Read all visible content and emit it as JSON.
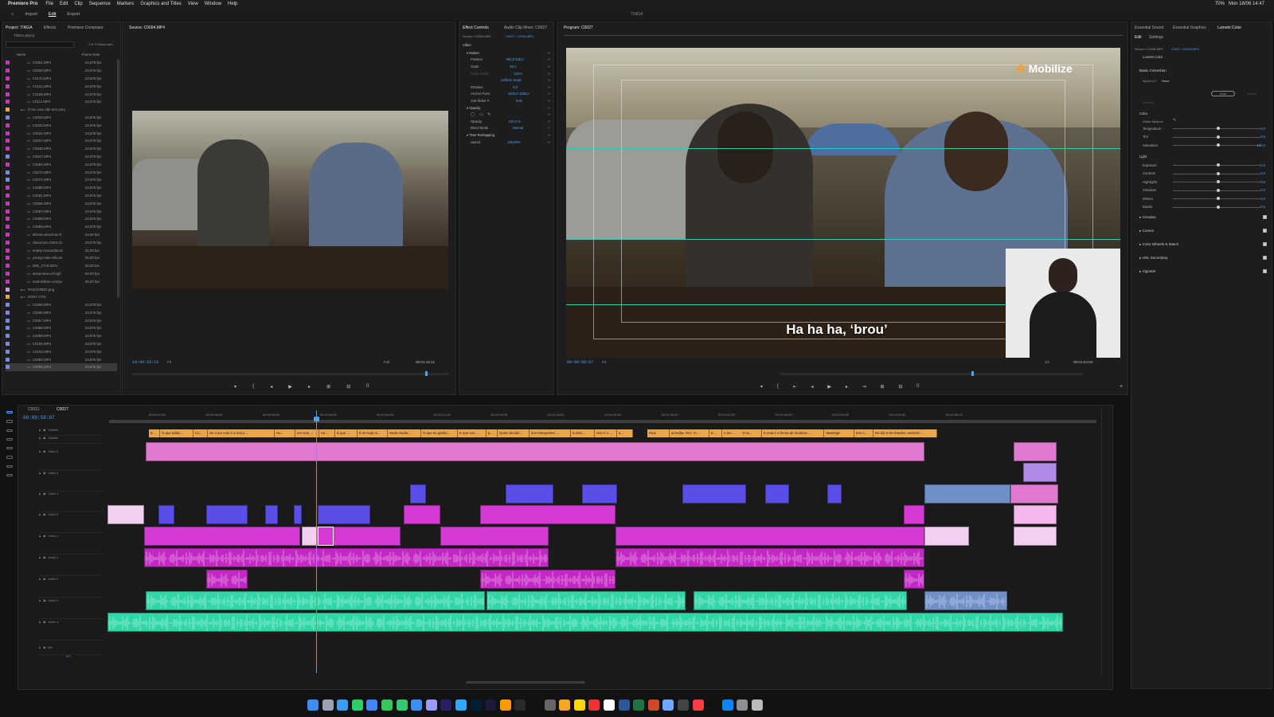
{
  "os_menu": {
    "app_name": "Premiere Pro",
    "items": [
      "File",
      "Edit",
      "Clip",
      "Sequence",
      "Markers",
      "Graphics and Titles",
      "View",
      "Window",
      "Help"
    ],
    "clock": "Mon 18/06  14:47",
    "battery": "70%"
  },
  "window_title": "TINGA",
  "workspaces": [
    "Import",
    "Edit",
    "Export"
  ],
  "active_workspace": "Edit",
  "project_panel": {
    "tabs": [
      "Project: TINGA",
      "Effects",
      "Premiere Composer"
    ],
    "project_file": "TINGA.prproj",
    "item_count": "1 of 74 items sele...",
    "col_name": "Name",
    "col_rate": "Frame Rate",
    "items": [
      {
        "name": "C0061.MP4",
        "rate": "23,976 fps",
        "color": "#c23bb6",
        "indent": 2
      },
      {
        "name": "C0063.MP4",
        "rate": "23,976 fps",
        "color": "#c23bb6",
        "indent": 2
      },
      {
        "name": "C0170.MP4",
        "rate": "23,976 fps",
        "color": "#c23bb6",
        "indent": 2
      },
      {
        "name": "C0101.MP4",
        "rate": "23,976 fps",
        "color": "#c23bb6",
        "indent": 2
      },
      {
        "name": "C0109.MP4",
        "rate": "23,976 fps",
        "color": "#c23bb6",
        "indent": 2
      },
      {
        "name": "C0111.MP4",
        "rate": "23,976 fps",
        "color": "#c23bb6",
        "indent": 2
      },
      {
        "name": "O teu voto não tem preç",
        "rate": "",
        "color": "#e8a54a",
        "indent": 1
      },
      {
        "name": "C0009.MP4",
        "rate": "23,976 fps",
        "color": "#7a8cd8",
        "indent": 2
      },
      {
        "name": "C0020.MP4",
        "rate": "23,976 fps",
        "color": "#c23bb6",
        "indent": 2
      },
      {
        "name": "C0024.MP4",
        "rate": "23,976 fps",
        "color": "#c23bb6",
        "indent": 2
      },
      {
        "name": "C0027.MP4",
        "rate": "23,976 fps",
        "color": "#c23bb6",
        "indent": 2
      },
      {
        "name": "C0038.MP4",
        "rate": "23,976 fps",
        "color": "#c23bb6",
        "indent": 2
      },
      {
        "name": "C0047.MP4",
        "rate": "23,976 fps",
        "color": "#7a8cd8",
        "indent": 2
      },
      {
        "name": "C0053.MP4",
        "rate": "23,976 fps",
        "color": "#c23bb6",
        "indent": 2
      },
      {
        "name": "C0072.MP4",
        "rate": "23,976 fps",
        "color": "#7a8cd8",
        "indent": 2
      },
      {
        "name": "C0074.MP4",
        "rate": "23,976 fps",
        "color": "#7a8cd8",
        "indent": 2
      },
      {
        "name": "C0080.MP4",
        "rate": "23,976 fps",
        "color": "#c23bb6",
        "indent": 2
      },
      {
        "name": "C0081.MP4",
        "rate": "23,976 fps",
        "color": "#c23bb6",
        "indent": 2
      },
      {
        "name": "C0085.MP4",
        "rate": "23,976 fps",
        "color": "#c23bb6",
        "indent": 2
      },
      {
        "name": "C0087.MP4",
        "rate": "23,976 fps",
        "color": "#c23bb6",
        "indent": 2
      },
      {
        "name": "C0088.MP4",
        "rate": "23,976 fps",
        "color": "#c23bb6",
        "indent": 2
      },
      {
        "name": "C0099.MP4",
        "rate": "23,976 fps",
        "color": "#c23bb6",
        "indent": 2
      },
      {
        "name": "african-american-b",
        "rate": "24,00 fps",
        "color": "#c23bb6",
        "indent": 2
      },
      {
        "name": "classroom-2023-11-",
        "rate": "23,976 fps",
        "color": "#c23bb6",
        "indent": 2
      },
      {
        "name": "empty-mozambican",
        "rate": "25,00 fps",
        "color": "#c23bb6",
        "indent": 2
      },
      {
        "name": "young-male-african",
        "rate": "25,00 fps",
        "color": "#c23bb6",
        "indent": 2
      },
      {
        "name": "IMG_4719.MOV",
        "rate": "30,00 fps",
        "color": "#c23bb6",
        "indent": 2
      },
      {
        "name": "aerial-view-of-high",
        "rate": "50,00 fps",
        "color": "#c23bb6",
        "indent": 2
      },
      {
        "name": "load-dollars-compu",
        "rate": "30,00 fps",
        "color": "#c23bb6",
        "indent": 2
      },
      {
        "name": "PASCORDO.png",
        "rate": "",
        "color": "#c8a0d8",
        "indent": 1
      },
      {
        "name": "SONY A7IV",
        "rate": "",
        "color": "#e8a54a",
        "indent": 1
      },
      {
        "name": "C0065.MP4",
        "rate": "23,976 fps",
        "color": "#7a8cd8",
        "indent": 2
      },
      {
        "name": "C0066.MP4",
        "rate": "23,976 fps",
        "color": "#7a8cd8",
        "indent": 2
      },
      {
        "name": "C0067.MP4",
        "rate": "23,976 fps",
        "color": "#7a8cd8",
        "indent": 2
      },
      {
        "name": "C0068.MP4",
        "rate": "23,976 fps",
        "color": "#7a8cd8",
        "indent": 2
      },
      {
        "name": "C0069.MP4",
        "rate": "23,976 fps",
        "color": "#7a8cd8",
        "indent": 2
      },
      {
        "name": "C0190.MP4",
        "rate": "23,976 fps",
        "color": "#7a8cd8",
        "indent": 2
      },
      {
        "name": "C0192.MP4",
        "rate": "23,976 fps",
        "color": "#7a8cd8",
        "indent": 2
      },
      {
        "name": "C0094.MP4",
        "rate": "23,976 fps",
        "color": "#7a8cd8",
        "indent": 2
      },
      {
        "name": "C0095.MP4",
        "rate": "23,976 fps",
        "color": "#7a8cd8",
        "indent": 2
      }
    ]
  },
  "source_monitor": {
    "tab": "Source: C0094.MP4",
    "timecode": "18:40:33:23",
    "fit": "Fit",
    "quality": "Full",
    "duration": "00:01:15:11"
  },
  "effect_controls": {
    "tabs": [
      "Effect Controls",
      "Audio Clip Mixer: C0027"
    ],
    "master": "Source • C0094.MP4",
    "clip": "C0027 • C0094.MP4",
    "section_video": "Video",
    "rows": [
      {
        "label": "Motion",
        "value": "",
        "indent": 1,
        "section": true
      },
      {
        "label": "Position",
        "value": "960,0    540,0",
        "indent": 2
      },
      {
        "label": "Scale",
        "value": "50,0",
        "indent": 2
      },
      {
        "label": "Scale Width",
        "value": "100,0",
        "indent": 2,
        "dim": true
      },
      {
        "label": "",
        "value": "Uniform Scale",
        "indent": 3
      },
      {
        "label": "Rotation",
        "value": "0,0",
        "indent": 2
      },
      {
        "label": "Anchor Point",
        "value": "1920,0    1080,0",
        "indent": 2
      },
      {
        "label": "Anti-flicker F..",
        "value": "0,00",
        "indent": 2
      },
      {
        "label": "Opacity",
        "value": "",
        "indent": 1,
        "section": true
      },
      {
        "label": "",
        "value": "",
        "indent": 2,
        "tools": true
      },
      {
        "label": "Opacity",
        "value": "100,0 %",
        "indent": 2
      },
      {
        "label": "Blend Mode",
        "value": "Normal",
        "indent": 2
      },
      {
        "label": "Time Remapping",
        "value": "",
        "indent": 1,
        "section": true
      },
      {
        "label": "Speed",
        "value": "100,00%",
        "indent": 2
      }
    ],
    "timecode": "00:09:58:07"
  },
  "program_monitor": {
    "tab": "Program: C0027",
    "timecode": "00:09:58:07",
    "fit": "Fit",
    "ratio": "1/4",
    "duration": "00:01:24:02",
    "subtitle": "Ha ha ha, ‘brou’",
    "logo_text": "Mobilize"
  },
  "lumetri": {
    "tabs": [
      "Essential Sound",
      "Essential Graphics",
      "Lumetri Color"
    ],
    "subtabs": [
      "Edit",
      "Settings"
    ],
    "source": "Source • C0094.MP4",
    "clip": "C0027 • C0094.MP4",
    "effect": "Lumetri Color",
    "basic_correction": "Basic Correction",
    "input_lut_label": "Input LUT",
    "input_lut_value": "None",
    "auto_label": "Auto",
    "reset_label": "Reset",
    "intensity_label": "Intensity",
    "color_label": "Color",
    "white_balance": "White Balance",
    "color_sliders": [
      {
        "label": "Temperature",
        "value": "0,0",
        "pos": 0.5
      },
      {
        "label": "Tint",
        "value": "0,0",
        "pos": 0.5
      },
      {
        "label": "Saturation",
        "value": "100,0",
        "pos": 0.5
      }
    ],
    "light_label": "Light",
    "light_sliders": [
      {
        "label": "Exposure",
        "value": "0,0",
        "pos": 0.5
      },
      {
        "label": "Contrast",
        "value": "0,0",
        "pos": 0.5
      },
      {
        "label": "Highlights",
        "value": "0,0",
        "pos": 0.5
      },
      {
        "label": "Shadows",
        "value": "0,0",
        "pos": 0.5
      },
      {
        "label": "Whites",
        "value": "0,0",
        "pos": 0.5
      },
      {
        "label": "Blacks",
        "value": "0,0",
        "pos": 0.5
      }
    ],
    "sections": [
      "Creative",
      "Curves",
      "Color Wheels & Match",
      "HSL Secondary",
      "Vignette"
    ]
  },
  "timeline": {
    "tabs": [
      "C0011",
      "C0027"
    ],
    "timecode": "00:09:58:07",
    "ruler": [
      "00:09:42:00",
      "00:09:48:00",
      "00:09:54:00",
      "00:10:00:00",
      "00:10:06:00",
      "00:10:12:00",
      "00:10:18:00",
      "00:10:24:00",
      "00:10:30:00",
      "00:10:36:00",
      "00:10:42:00",
      "00:10:48:00",
      "00:10:54:00",
      "00:11:00:00",
      "00:11:06:00"
    ],
    "tracks": [
      {
        "name": "Subtitle"
      },
      {
        "name": "Subtitle"
      },
      {
        "name": "Video 5"
      },
      {
        "name": "Video 4"
      },
      {
        "name": "Video 3"
      },
      {
        "name": "Video 2"
      },
      {
        "name": "Video 1"
      },
      {
        "name": "Audio 1"
      },
      {
        "name": "Audio 2"
      },
      {
        "name": "Audio 3"
      },
      {
        "name": "Audio 4"
      },
      {
        "name": "Mix"
      }
    ],
    "mix_value": "0,0",
    "captions": [
      "E...",
      "O que adian...",
      "Co...",
      "Se o teu voto é a única ...",
      "Hu...",
      "um voto ...",
      "Ha ...",
      "É que ...",
      "É de toda m...",
      "Nada mudar...",
      "O que eu ganho...",
      "E que nos ...",
      "p...",
      "Quem decide...",
      "dos transportes, ...",
      "E eles ...",
      "Isso é o ...",
      "a...",
      "Hum",
      "acredita, 'bro', m...",
      "E...",
      "o teu ...",
      "E ta...",
      "E esta é a forma de mudares ...",
      "'Maninga'",
      "tem c...",
      "No dia 9 de Outubro, também ..."
    ]
  },
  "dock_icons": [
    "finder",
    "launchpad",
    "safari",
    "whatsapp",
    "chrome",
    "messages",
    "facetime",
    "mail",
    "after-effects",
    "premiere",
    "lightroom",
    "photoshop",
    "media-encoder",
    "illustrator",
    "davinci",
    "capcut",
    "app",
    "photos",
    "notes",
    "pdf",
    "calendar",
    "word",
    "excel",
    "powerpoint",
    "finder2",
    "clock",
    "music",
    "tv",
    "app-store",
    "settings",
    "trash"
  ],
  "colors": {
    "caption": "#e8a54a",
    "video5": "#e07ad0",
    "magenta": "#d63ad6",
    "purple_blue": "#5a4ee8",
    "steel": "#6f8fc9",
    "audio_magenta": "#c428c4",
    "audio_teal": "#2fd6a8",
    "playhead": "#4aa3ff"
  }
}
